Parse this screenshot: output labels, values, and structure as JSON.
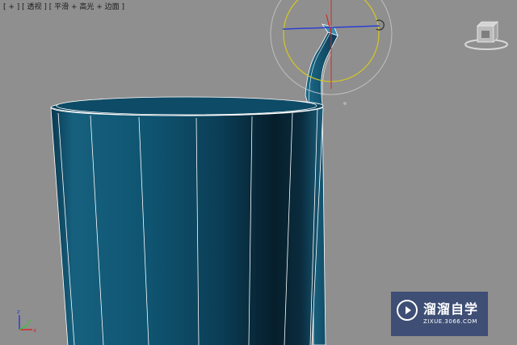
{
  "viewport": {
    "label": "[ + ] [ 透视 ] [ 平滑 + 高光 + 边面 ]",
    "background": "#8f8f8f"
  },
  "scene": {
    "object_color": "#0e4a64",
    "edge_color": "#ffffff",
    "gizmo": {
      "ring_color": "#d6c623",
      "x_axis_color": "#2b3fd0",
      "y_axis_color": "#d02b2b"
    },
    "axis_tripod": {
      "x_label": "x",
      "y_label": "y",
      "z_label": "z"
    }
  },
  "watermark": {
    "brand": "溜溜自学",
    "url": "ZIXUE.3066.COM"
  }
}
